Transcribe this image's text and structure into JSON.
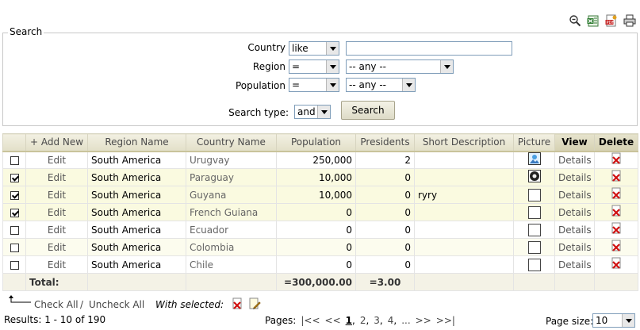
{
  "search": {
    "legend": "Search",
    "country_label": "Country",
    "country_op": "like",
    "country_value": "",
    "region_label": "Region",
    "region_op": "=",
    "region_value": "-- any --",
    "population_label": "Population",
    "population_op": "=",
    "population_value": "-- any --",
    "search_type_label": "Search type:",
    "search_type_value": "and",
    "search_button": "Search"
  },
  "toolbar": {
    "icons": [
      "zoom-out-icon",
      "excel-export-icon",
      "pdf-export-icon",
      "print-icon"
    ]
  },
  "grid": {
    "headers": {
      "add_new": "+ Add New",
      "region": "Region Name",
      "country": "Country Name",
      "population": "Population",
      "presidents": "Presidents",
      "short_description": "Short Description",
      "picture": "Picture",
      "view": "View",
      "delete": "Delete"
    },
    "rows": [
      {
        "checked": false,
        "edit": "Edit",
        "region": "South America",
        "country": "Urugvay",
        "population": "250,000",
        "presidents": "2",
        "description": "",
        "picture": "image",
        "view": "Details"
      },
      {
        "checked": true,
        "edit": "Edit",
        "region": "South America",
        "country": "Paraguay",
        "population": "10,000",
        "presidents": "0",
        "description": "",
        "picture": "image-dark",
        "view": "Details"
      },
      {
        "checked": true,
        "edit": "Edit",
        "region": "South America",
        "country": "Guyana",
        "population": "10,000",
        "presidents": "0",
        "description": "ryry",
        "picture": "empty",
        "view": "Details"
      },
      {
        "checked": true,
        "edit": "Edit",
        "region": "South America",
        "country": "French Guiana",
        "population": "0",
        "presidents": "0",
        "description": "",
        "picture": "empty",
        "view": "Details"
      },
      {
        "checked": false,
        "edit": "Edit",
        "region": "South America",
        "country": "Ecuador",
        "population": "0",
        "presidents": "0",
        "description": "",
        "picture": "empty",
        "view": "Details"
      },
      {
        "checked": false,
        "edit": "Edit",
        "region": "South America",
        "country": "Colombia",
        "population": "0",
        "presidents": "0",
        "description": "",
        "picture": "empty",
        "view": "Details"
      },
      {
        "checked": false,
        "edit": "Edit",
        "region": "South America",
        "country": "Chile",
        "population": "0",
        "presidents": "0",
        "description": "",
        "picture": "empty",
        "view": "Details"
      }
    ],
    "total_label": "Total:",
    "total_population": "=300,000.00",
    "total_presidents": "=3.00"
  },
  "footer": {
    "check_all": "Check All",
    "separator": "/",
    "uncheck_all": "Uncheck All",
    "with_selected": "With selected:",
    "results": "Results: 1 - 10 of 190",
    "pages_label": "Pages:",
    "pager": {
      "first": "|<<",
      "prev": "<<",
      "current": "1",
      "p2": "2",
      "p3": "3",
      "p4": "4",
      "ellipsis": "...",
      "next": ">>",
      "last": ">>|"
    },
    "page_size_label": "Page size:",
    "page_size_value": "10"
  },
  "colors": {
    "header_bg": "#e2dfc8",
    "selected_row_bg": "#fafae0",
    "delete_icon": "#d01010"
  }
}
